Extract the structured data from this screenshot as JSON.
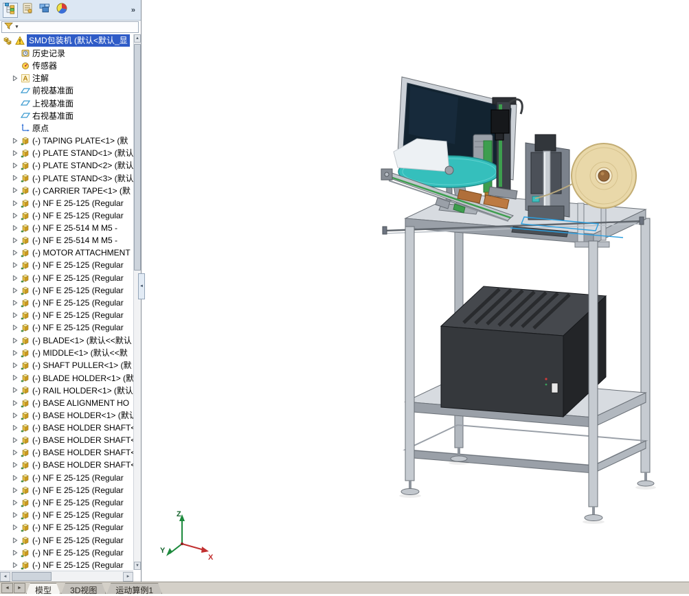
{
  "colors": {
    "selection": "#2e5bc7",
    "panel-toolbar": "#dce7f3",
    "statusbar-bg": "#d4d0c8",
    "frame-top": "#d7dbe0",
    "frame-light": "#c6cbd1",
    "frame-mid": "#b2b8bf",
    "frame-shadow": "#9aa0a8",
    "frame-edge": "#6b7178",
    "box": "#35383c",
    "box-top": "#45484d",
    "box-side": "#232528",
    "teal": "#35bfbc",
    "reel": "#e9d8a9",
    "reel-edge": "#c3ad74",
    "monitor-screen": "#122330",
    "monitor-frame": "#ccd1d7",
    "green": "#3d9e4e",
    "copper": "#b06f3a",
    "blue-line": "#2b9fe0"
  },
  "feature_manager": {
    "toolbar": {
      "icons": [
        "design-tree-icon",
        "property-manager-icon",
        "configuration-manager-icon",
        "display-manager-icon"
      ],
      "overflow_label": "»"
    },
    "filter": {
      "caret": "▼"
    },
    "root": {
      "label": "SMD包装机 (默认<默认_显"
    },
    "items": [
      {
        "icon": "history-icon",
        "label": "历史记录",
        "expandable": false
      },
      {
        "icon": "sensors-icon",
        "label": "传感器",
        "expandable": false
      },
      {
        "icon": "annotations-icon",
        "label": "注解",
        "expandable": true
      },
      {
        "icon": "plane-icon",
        "label": "前视基准面",
        "expandable": false
      },
      {
        "icon": "plane-icon",
        "label": "上视基准面",
        "expandable": false
      },
      {
        "icon": "plane-icon",
        "label": "右视基准面",
        "expandable": false
      },
      {
        "icon": "origin-icon",
        "label": "原点",
        "expandable": false
      },
      {
        "icon": "part-icon",
        "label": "(-) TAPING PLATE<1> (默",
        "expandable": true
      },
      {
        "icon": "part-icon",
        "label": "(-) PLATE STAND<1> (默认",
        "expandable": true
      },
      {
        "icon": "part-icon",
        "label": "(-) PLATE STAND<2> (默认",
        "expandable": true
      },
      {
        "icon": "part-icon",
        "label": "(-) PLATE STAND<3> (默认",
        "expandable": true
      },
      {
        "icon": "part-icon",
        "label": "(-) CARRIER TAPE<1> (默",
        "expandable": true
      },
      {
        "icon": "part-icon",
        "label": "(-) NF E 25-125  (Regular",
        "expandable": true
      },
      {
        "icon": "part-icon",
        "label": "(-) NF E 25-125  (Regular",
        "expandable": true
      },
      {
        "icon": "part-icon",
        "label": "(-) NF E 25-514  M M5 - ",
        "expandable": true
      },
      {
        "icon": "part-icon",
        "label": "(-) NF E 25-514  M M5 - ",
        "expandable": true
      },
      {
        "icon": "part-icon",
        "label": "(-) MOTOR ATTACHMENT",
        "expandable": true
      },
      {
        "icon": "part-icon",
        "label": "(-) NF E 25-125  (Regular",
        "expandable": true
      },
      {
        "icon": "part-icon",
        "label": "(-) NF E 25-125  (Regular",
        "expandable": true
      },
      {
        "icon": "part-icon",
        "label": "(-) NF E 25-125  (Regular",
        "expandable": true
      },
      {
        "icon": "part-icon",
        "label": "(-) NF E 25-125  (Regular",
        "expandable": true
      },
      {
        "icon": "part-icon",
        "label": "(-) NF E 25-125  (Regular",
        "expandable": true
      },
      {
        "icon": "part-icon",
        "label": "(-) NF E 25-125  (Regular",
        "expandable": true
      },
      {
        "icon": "part-icon",
        "label": "(-) BLADE<1> (默认<<默认",
        "expandable": true
      },
      {
        "icon": "part-icon",
        "label": "(-) MIDDLE<1> (默认<<默",
        "expandable": true
      },
      {
        "icon": "part-icon",
        "label": "(-) SHAFT PULLER<1> (默",
        "expandable": true
      },
      {
        "icon": "part-icon",
        "label": "(-) BLADE HOLDER<1> (默",
        "expandable": true
      },
      {
        "icon": "part-icon",
        "label": "(-) RAIL HOLDER<1> (默认",
        "expandable": true
      },
      {
        "icon": "part-icon",
        "label": "(-) BASE ALIGNMENT HO",
        "expandable": true
      },
      {
        "icon": "part-icon",
        "label": "(-) BASE HOLDER<1> (默认",
        "expandable": true
      },
      {
        "icon": "part-icon",
        "label": "(-) BASE HOLDER SHAFT<",
        "expandable": true
      },
      {
        "icon": "part-icon",
        "label": "(-) BASE HOLDER SHAFT<",
        "expandable": true
      },
      {
        "icon": "part-icon",
        "label": "(-) BASE HOLDER SHAFT<",
        "expandable": true
      },
      {
        "icon": "part-icon",
        "label": "(-) BASE HOLDER SHAFT<",
        "expandable": true
      },
      {
        "icon": "part-icon",
        "label": "(-) NF E 25-125  (Regular",
        "expandable": true
      },
      {
        "icon": "part-icon",
        "label": "(-) NF E 25-125  (Regular",
        "expandable": true
      },
      {
        "icon": "part-icon",
        "label": "(-) NF E 25-125  (Regular",
        "expandable": true
      },
      {
        "icon": "part-icon",
        "label": "(-) NF E 25-125  (Regular",
        "expandable": true
      },
      {
        "icon": "part-icon",
        "label": "(-) NF E 25-125  (Regular",
        "expandable": true
      },
      {
        "icon": "part-icon",
        "label": "(-) NF E 25-125  (Regular",
        "expandable": true
      },
      {
        "icon": "part-icon",
        "label": "(-) NF E 25-125  (Regular",
        "expandable": true
      },
      {
        "icon": "part-icon",
        "label": "(-) NF E 25-125  (Regular",
        "expandable": true
      }
    ]
  },
  "scroll": {
    "up": "▲",
    "down": "▼",
    "left": "◄",
    "right": "►",
    "splitter": "◄"
  },
  "statusbar": {
    "nav_left": "◄",
    "nav_right": "►",
    "tabs": [
      {
        "label": "模型",
        "active": true
      },
      {
        "label": "3D视图",
        "active": false
      },
      {
        "label": "运动算例1",
        "active": false
      }
    ]
  },
  "viewport": {
    "triad": {
      "x": "X",
      "y": "Y",
      "z": "Z"
    }
  }
}
